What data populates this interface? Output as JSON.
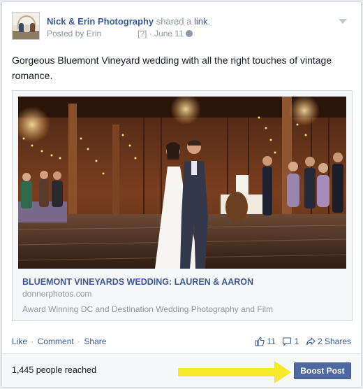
{
  "post": {
    "page_name": "Nick & Erin Photography",
    "shared_text": " shared a ",
    "link_word": "link",
    "period": ".",
    "posted_by": "Posted by Erin",
    "privacy_tag": "[?]",
    "date": " · June 11",
    "message": "Gorgeous Bluemont Vineyard wedding with all the right touches of vintage romance."
  },
  "link_preview": {
    "title": "BLUEMONT VINEYARDS WEDDING: LAUREN & AARON",
    "domain": "donnerphotos.com",
    "description": "Award Winning DC and Destination Wedding Photography and Film"
  },
  "actions": {
    "like": "Like",
    "comment": "Comment",
    "share": "Share",
    "separator": "·"
  },
  "stats": {
    "likes": "11",
    "comments": "1",
    "shares": "2 Shares"
  },
  "footer": {
    "reach": "1,445 people reached",
    "boost_label": "Boost Post",
    "arrow_color": "#f5e92a",
    "button_color": "#4e69a2"
  },
  "icons": {
    "page_avatar": "avatar",
    "audience": "globe-icon",
    "menu": "chevron-down-icon",
    "like": "thumbs-up-icon",
    "comment": "comment-icon",
    "share": "share-arrow-icon"
  }
}
